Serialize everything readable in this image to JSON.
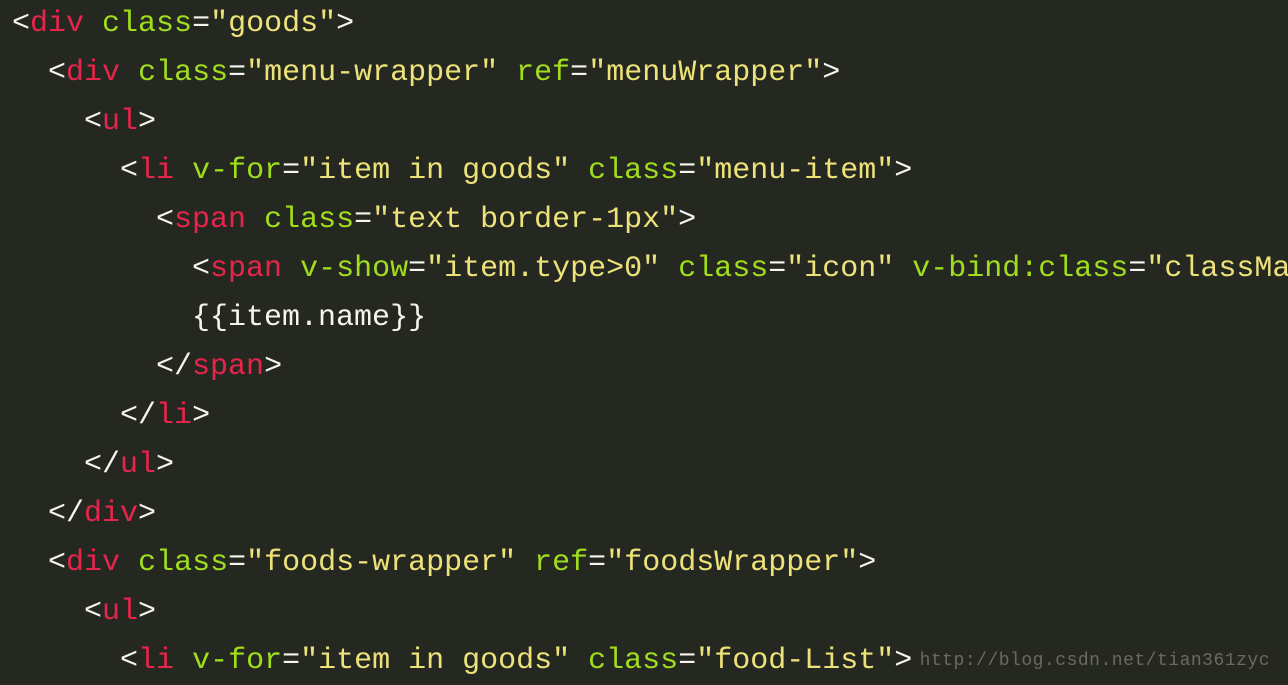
{
  "colors": {
    "background": "#252821",
    "punc": "#f5f5ef",
    "tag": "#e6254b",
    "attr": "#a0de1d",
    "str": "#ede279"
  },
  "watermark": "http://blog.csdn.net/tian361zyc",
  "lines": [
    {
      "indent": 0,
      "tokens": [
        {
          "k": "punc",
          "t": "<"
        },
        {
          "k": "tag",
          "t": "div"
        },
        {
          "k": "punc",
          "t": " "
        },
        {
          "k": "attr",
          "t": "class"
        },
        {
          "k": "punc",
          "t": "="
        },
        {
          "k": "str",
          "t": "\"goods\""
        },
        {
          "k": "punc",
          "t": ">"
        }
      ]
    },
    {
      "indent": 1,
      "tokens": [
        {
          "k": "punc",
          "t": "<"
        },
        {
          "k": "tag",
          "t": "div"
        },
        {
          "k": "punc",
          "t": " "
        },
        {
          "k": "attr",
          "t": "class"
        },
        {
          "k": "punc",
          "t": "="
        },
        {
          "k": "str",
          "t": "\"menu-wrapper\""
        },
        {
          "k": "punc",
          "t": " "
        },
        {
          "k": "attr",
          "t": "ref"
        },
        {
          "k": "punc",
          "t": "="
        },
        {
          "k": "str",
          "t": "\"menuWrapper\""
        },
        {
          "k": "punc",
          "t": ">"
        }
      ]
    },
    {
      "indent": 2,
      "tokens": [
        {
          "k": "punc",
          "t": "<"
        },
        {
          "k": "tag",
          "t": "ul"
        },
        {
          "k": "punc",
          "t": ">"
        }
      ]
    },
    {
      "indent": 3,
      "tokens": [
        {
          "k": "punc",
          "t": "<"
        },
        {
          "k": "tag",
          "t": "li"
        },
        {
          "k": "punc",
          "t": " "
        },
        {
          "k": "attr",
          "t": "v-for"
        },
        {
          "k": "punc",
          "t": "="
        },
        {
          "k": "str",
          "t": "\"item in goods\""
        },
        {
          "k": "punc",
          "t": " "
        },
        {
          "k": "attr",
          "t": "class"
        },
        {
          "k": "punc",
          "t": "="
        },
        {
          "k": "str",
          "t": "\"menu-item\""
        },
        {
          "k": "punc",
          "t": ">"
        }
      ]
    },
    {
      "indent": 4,
      "tokens": [
        {
          "k": "punc",
          "t": "<"
        },
        {
          "k": "tag",
          "t": "span"
        },
        {
          "k": "punc",
          "t": " "
        },
        {
          "k": "attr",
          "t": "class"
        },
        {
          "k": "punc",
          "t": "="
        },
        {
          "k": "str",
          "t": "\"text border-1px\""
        },
        {
          "k": "punc",
          "t": ">"
        }
      ]
    },
    {
      "indent": 5,
      "tokens": [
        {
          "k": "punc",
          "t": "<"
        },
        {
          "k": "tag",
          "t": "span"
        },
        {
          "k": "punc",
          "t": " "
        },
        {
          "k": "attr",
          "t": "v-show"
        },
        {
          "k": "punc",
          "t": "="
        },
        {
          "k": "str",
          "t": "\"item.type>0\""
        },
        {
          "k": "punc",
          "t": " "
        },
        {
          "k": "attr",
          "t": "class"
        },
        {
          "k": "punc",
          "t": "="
        },
        {
          "k": "str",
          "t": "\"icon\""
        },
        {
          "k": "punc",
          "t": " "
        },
        {
          "k": "attr",
          "t": "v-bind:class"
        },
        {
          "k": "punc",
          "t": "="
        },
        {
          "k": "str",
          "t": "\"classMa"
        }
      ]
    },
    {
      "indent": 5,
      "tokens": [
        {
          "k": "txt",
          "t": "{{item.name}}"
        }
      ]
    },
    {
      "indent": 4,
      "tokens": [
        {
          "k": "punc",
          "t": "</"
        },
        {
          "k": "tag",
          "t": "span"
        },
        {
          "k": "punc",
          "t": ">"
        }
      ]
    },
    {
      "indent": 3,
      "tokens": [
        {
          "k": "punc",
          "t": "</"
        },
        {
          "k": "tag",
          "t": "li"
        },
        {
          "k": "punc",
          "t": ">"
        }
      ]
    },
    {
      "indent": 2,
      "tokens": [
        {
          "k": "punc",
          "t": "</"
        },
        {
          "k": "tag",
          "t": "ul"
        },
        {
          "k": "punc",
          "t": ">"
        }
      ]
    },
    {
      "indent": 1,
      "tokens": [
        {
          "k": "punc",
          "t": "</"
        },
        {
          "k": "tag",
          "t": "div"
        },
        {
          "k": "punc",
          "t": ">"
        }
      ]
    },
    {
      "indent": 1,
      "tokens": [
        {
          "k": "punc",
          "t": "<"
        },
        {
          "k": "tag",
          "t": "div"
        },
        {
          "k": "punc",
          "t": " "
        },
        {
          "k": "attr",
          "t": "class"
        },
        {
          "k": "punc",
          "t": "="
        },
        {
          "k": "str",
          "t": "\"foods-wrapper\""
        },
        {
          "k": "punc",
          "t": " "
        },
        {
          "k": "attr",
          "t": "ref"
        },
        {
          "k": "punc",
          "t": "="
        },
        {
          "k": "str",
          "t": "\"foodsWrapper\""
        },
        {
          "k": "punc",
          "t": ">"
        }
      ]
    },
    {
      "indent": 2,
      "tokens": [
        {
          "k": "punc",
          "t": "<"
        },
        {
          "k": "tag",
          "t": "ul"
        },
        {
          "k": "punc",
          "t": ">"
        }
      ]
    },
    {
      "indent": 3,
      "tokens": [
        {
          "k": "punc",
          "t": "<"
        },
        {
          "k": "tag",
          "t": "li"
        },
        {
          "k": "punc",
          "t": " "
        },
        {
          "k": "attr",
          "t": "v-for"
        },
        {
          "k": "punc",
          "t": "="
        },
        {
          "k": "str",
          "t": "\"item in goods\""
        },
        {
          "k": "punc",
          "t": " "
        },
        {
          "k": "attr",
          "t": "class"
        },
        {
          "k": "punc",
          "t": "="
        },
        {
          "k": "str",
          "t": "\"food-List\""
        },
        {
          "k": "punc",
          "t": ">"
        }
      ]
    }
  ]
}
